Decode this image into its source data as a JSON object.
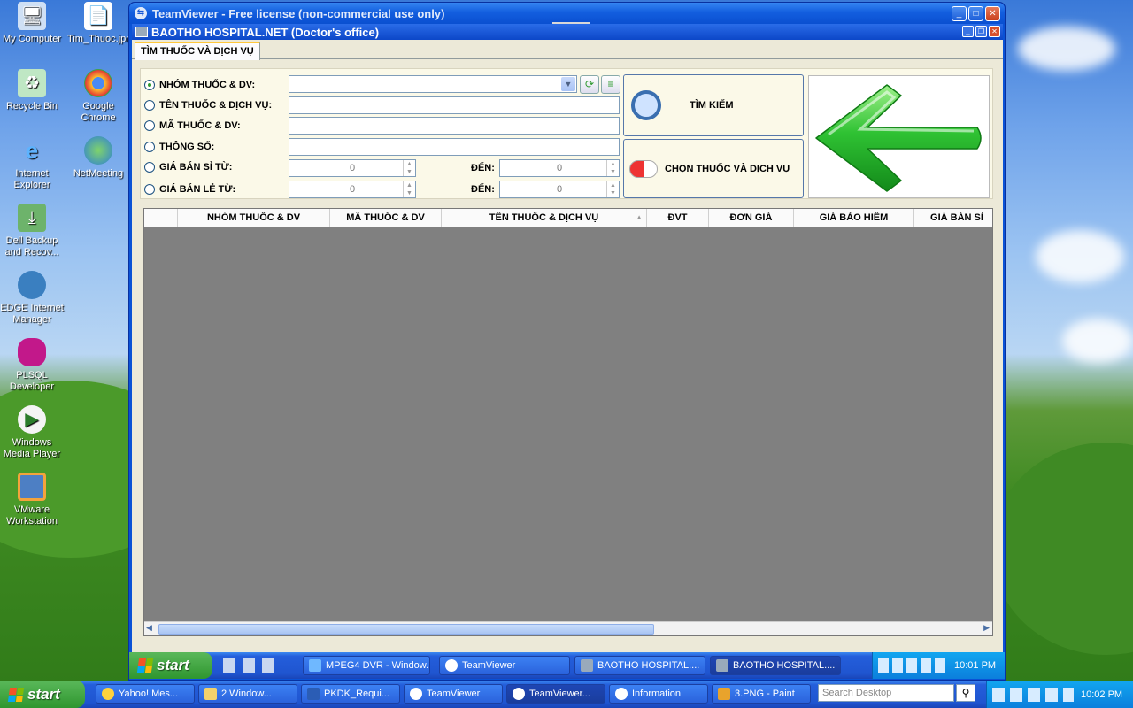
{
  "desktop": {
    "icons": [
      {
        "label": "My Computer",
        "icon": "computer-icon"
      },
      {
        "label": "Tim_Thuoc.jpr",
        "icon": "document-icon"
      },
      {
        "label": "Recycle Bin",
        "icon": "recycle-bin-icon"
      },
      {
        "label": "Google Chrome",
        "icon": "chrome-icon"
      },
      {
        "label": "Internet Explorer",
        "icon": "ie-icon"
      },
      {
        "label": "NetMeeting",
        "icon": "netmeeting-icon"
      },
      {
        "label": "Dell Backup and Recov...",
        "icon": "backup-icon"
      },
      {
        "label": "EDGE Internet Manager",
        "icon": "edge-icon"
      },
      {
        "label": "PLSQL Developer",
        "icon": "database-icon"
      },
      {
        "label": "Windows Media Player",
        "icon": "media-player-icon"
      },
      {
        "label": "VMware Workstation",
        "icon": "vmware-icon"
      }
    ]
  },
  "teamviewer": {
    "title": "TeamViewer - Free license (non-commercial use only)",
    "handle_glyph": "⌄"
  },
  "app": {
    "title": "BAOTHO HOSPITAL.NET (Doctor's office)",
    "tab": "TÌM THUỐC VÀ DỊCH VỤ",
    "filters": {
      "group": "NHÓM THUỐC & DV:",
      "name": "TÊN THUỐC & DỊCH VỤ:",
      "code": "MÃ THUỐC & DV:",
      "spec": "THÔNG SỐ:",
      "wholesale_from": "GIÁ BÁN SỈ TỪ:",
      "retail_from": "GIÁ BÁN LẺ TỪ:",
      "to_label": "ĐẾN:",
      "wholesale_min": "0",
      "wholesale_max": "0",
      "retail_min": "0",
      "retail_max": "0"
    },
    "search_button": "TÌM KIẾM",
    "select_button": "CHỌN THUỐC VÀ DỊCH VỤ",
    "columns": [
      "NHÓM THUỐC & DV",
      "MÃ THUỐC & DV",
      "TÊN THUỐC & DỊCH VỤ",
      "ĐVT",
      "ĐƠN GIÁ",
      "GIÁ BẢO HIỂM",
      "GIÁ BÁN SỈ"
    ],
    "sort_glyph": "▲"
  },
  "remote_taskbar": {
    "start": "start",
    "tasks": [
      "MPEG4 DVR - Window...",
      "TeamViewer",
      "BAOTHO HOSPITAL....",
      "BAOTHO HOSPITAL...."
    ],
    "time": "10:01 PM"
  },
  "local_taskbar": {
    "start": "start",
    "tasks": [
      "Yahoo! Mes...",
      "2 Window...",
      "PKDK_Requi...",
      "TeamViewer",
      "TeamViewer...",
      "Information",
      "3.PNG - Paint"
    ],
    "search_placeholder": "Search Desktop",
    "time": "10:02 PM"
  },
  "colors": {
    "accent": "#245edb",
    "start_green": "#3a9c3a",
    "panel_bg": "#fbf9e8",
    "grid_bg": "#808080"
  }
}
